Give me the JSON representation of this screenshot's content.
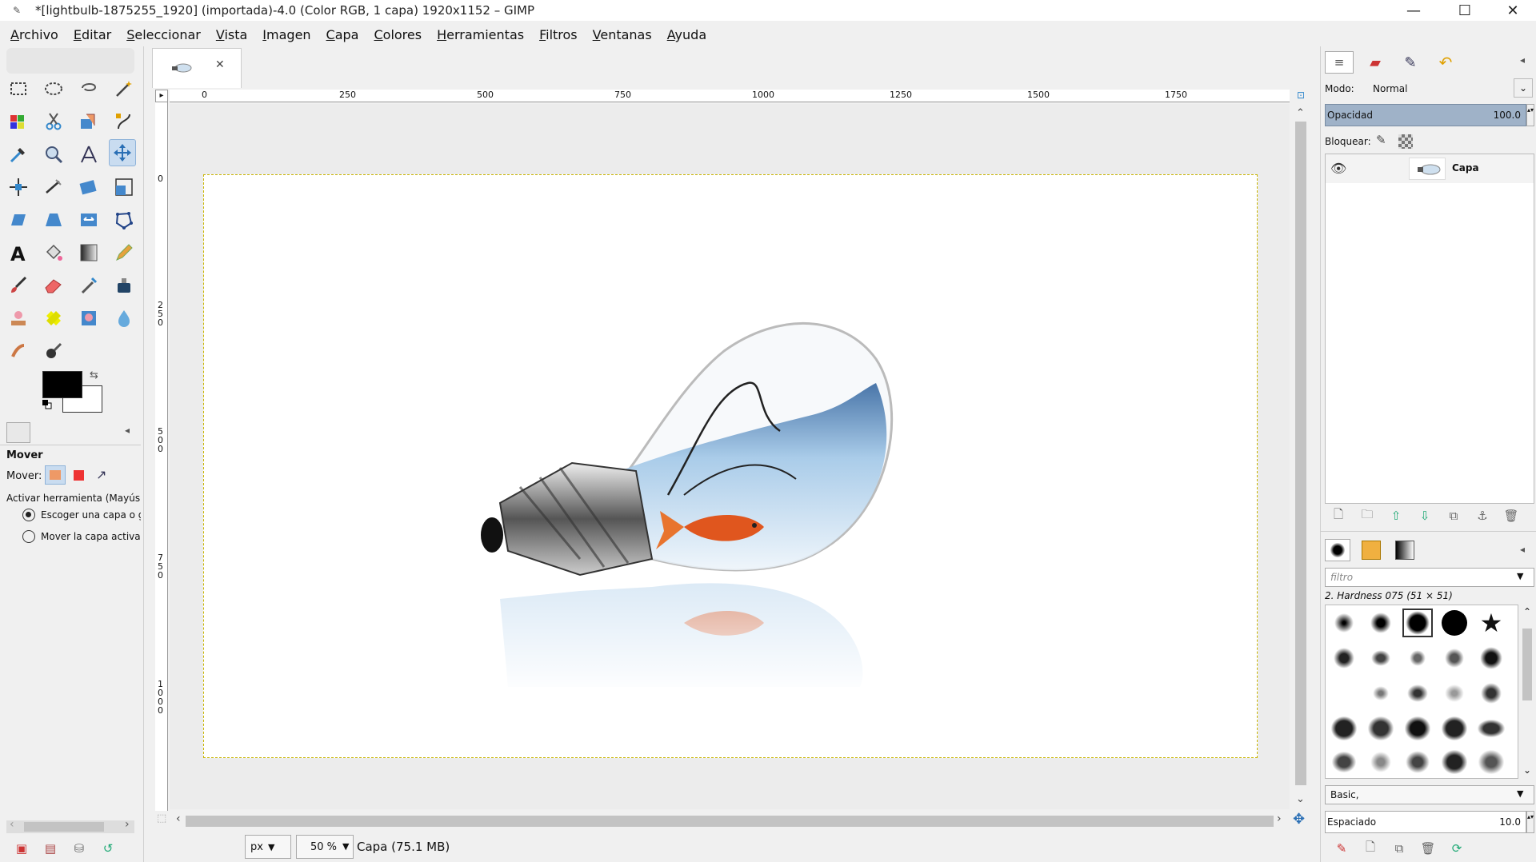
{
  "window": {
    "title": "*[lightbulb-1875255_1920] (importada)-4.0 (Color RGB, 1 capa) 1920x1152 – GIMP",
    "minimize_glyph": "—",
    "maximize_glyph": "☐",
    "close_glyph": "✕"
  },
  "menu": [
    "Archivo",
    "Editar",
    "Seleccionar",
    "Vista",
    "Imagen",
    "Capa",
    "Colores",
    "Herramientas",
    "Filtros",
    "Ventanas",
    "Ayuda"
  ],
  "image_tab": {
    "close_glyph": "✕"
  },
  "ruler": {
    "h_ticks": [
      "0",
      "250",
      "500",
      "750",
      "1000",
      "1250",
      "1500",
      "1750"
    ],
    "v_ticks": [
      "0",
      "250",
      "500",
      "750",
      "1000"
    ]
  },
  "tool_options": {
    "title": "Mover",
    "mover_label": "Mover:",
    "activar_label": "Activar herramienta  (Mayús)",
    "option1": "Escoger una capa o guía",
    "option2": "Mover la capa activa"
  },
  "status": {
    "unit": "px",
    "zoom": "50 %",
    "info": "Capa (75.1 MB)"
  },
  "layers": {
    "mode_label": "Modo:",
    "mode_value": "Normal",
    "opacity_label": "Opacidad",
    "opacity_value": "100.0",
    "lock_label": "Bloquear:",
    "layer_name": "Capa"
  },
  "brushes": {
    "filter_placeholder": "filtro",
    "current_brush": "2. Hardness 075 (51 × 51)",
    "preset": "Basic,",
    "spacing_label": "Espaciado",
    "spacing_value": "10.0"
  },
  "colors": {
    "foreground": "#000000",
    "background": "#ffffff",
    "selection_border": "#c8b400"
  }
}
